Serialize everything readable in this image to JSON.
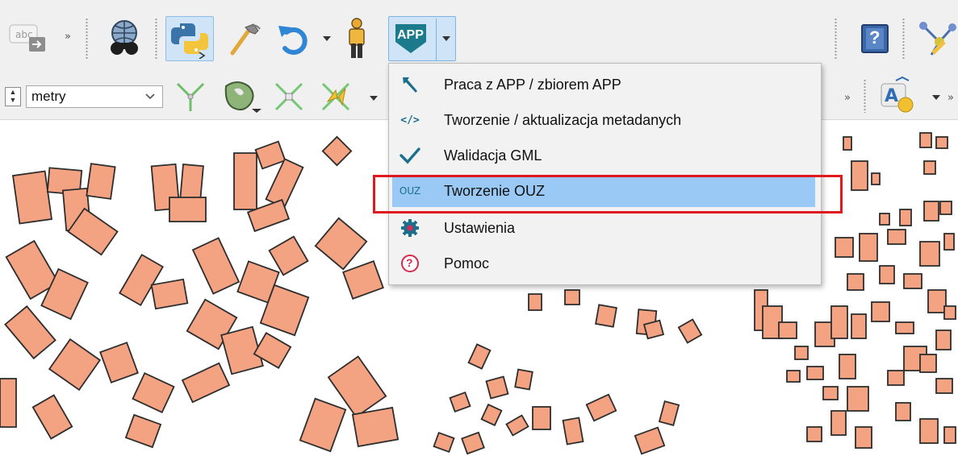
{
  "toolbar": {
    "abc_label": "abc",
    "app_button_label": "APP",
    "overflow_chevron": "»",
    "help_glyph": "?"
  },
  "toolbar2": {
    "units_value": "metry",
    "overflow_chevron": "»"
  },
  "menu": {
    "items": [
      {
        "label": "Praca z APP / zbiorem APP",
        "icon": "hammer-icon"
      },
      {
        "label": "Tworzenie / aktualizacja metadanych",
        "icon": "code-tags-icon",
        "icon_text": "</>"
      },
      {
        "label": "Walidacja GML",
        "icon": "checkmark-icon"
      },
      {
        "label": "Tworzenie OUZ",
        "icon": "ouz-icon",
        "icon_text": "OUZ",
        "active": true
      },
      {
        "label": "Ustawienia",
        "icon": "gear-icon"
      },
      {
        "label": "Pomoc",
        "icon": "help-circle-icon",
        "icon_text": "?"
      }
    ]
  },
  "colors": {
    "building_fill": "#f4a382",
    "building_stroke": "#2e2e2e",
    "menu_highlight": "#99c9f4",
    "annotation_red": "#e0191f",
    "app_icon_teal": "#1b7a8c"
  }
}
